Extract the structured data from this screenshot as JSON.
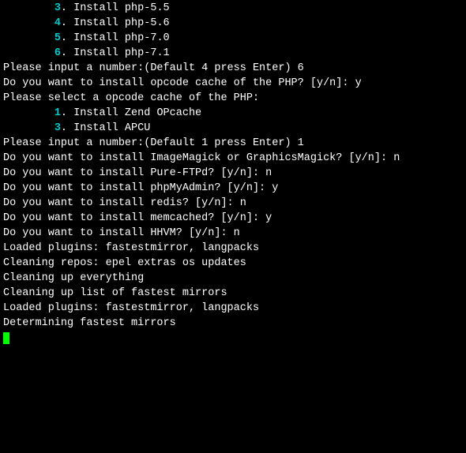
{
  "menu1": {
    "indent": "        ",
    "items": [
      {
        "num": "3",
        "label": ". Install php-5.5"
      },
      {
        "num": "4",
        "label": ". Install php-5.6"
      },
      {
        "num": "5",
        "label": ". Install php-7.0"
      },
      {
        "num": "6",
        "label": ". Install php-7.1"
      }
    ]
  },
  "prompt1_text": "Please input a number:(Default 4 press Enter) ",
  "prompt1_input": "6",
  "blank": "",
  "q_opcode_text": "Do you want to install opcode cache of the PHP? [y/n]: ",
  "q_opcode_input": "y",
  "opcode_select": "Please select a opcode cache of the PHP:",
  "menu2": {
    "indent": "        ",
    "items": [
      {
        "num": "1",
        "label": ". Install Zend OPcache"
      },
      {
        "num": "3",
        "label": ". Install APCU"
      }
    ]
  },
  "prompt2_text": "Please input a number:(Default 1 press Enter) ",
  "prompt2_input": "1",
  "q_im_text": "Do you want to install ImageMagick or GraphicsMagick? [y/n]: ",
  "q_im_input": "n",
  "q_ftpd_text": "Do you want to install Pure-FTPd? [y/n]: ",
  "q_ftpd_input": "n",
  "q_pma_text": "Do you want to install phpMyAdmin? [y/n]: ",
  "q_pma_input": "y",
  "q_redis_text": "Do you want to install redis? [y/n]: ",
  "q_redis_input": "n",
  "q_memcached_text": "Do you want to install memcached? [y/n]: ",
  "q_memcached_input": "y",
  "q_hhvm_text": "Do you want to install HHVM? [y/n]: ",
  "q_hhvm_input": "n",
  "out1": "Loaded plugins: fastestmirror, langpacks",
  "out2": "Cleaning repos: epel extras os updates",
  "out3": "Cleaning up everything",
  "out4": "Cleaning up list of fastest mirrors",
  "out5": "Loaded plugins: fastestmirror, langpacks",
  "out6": "Determining fastest mirrors"
}
